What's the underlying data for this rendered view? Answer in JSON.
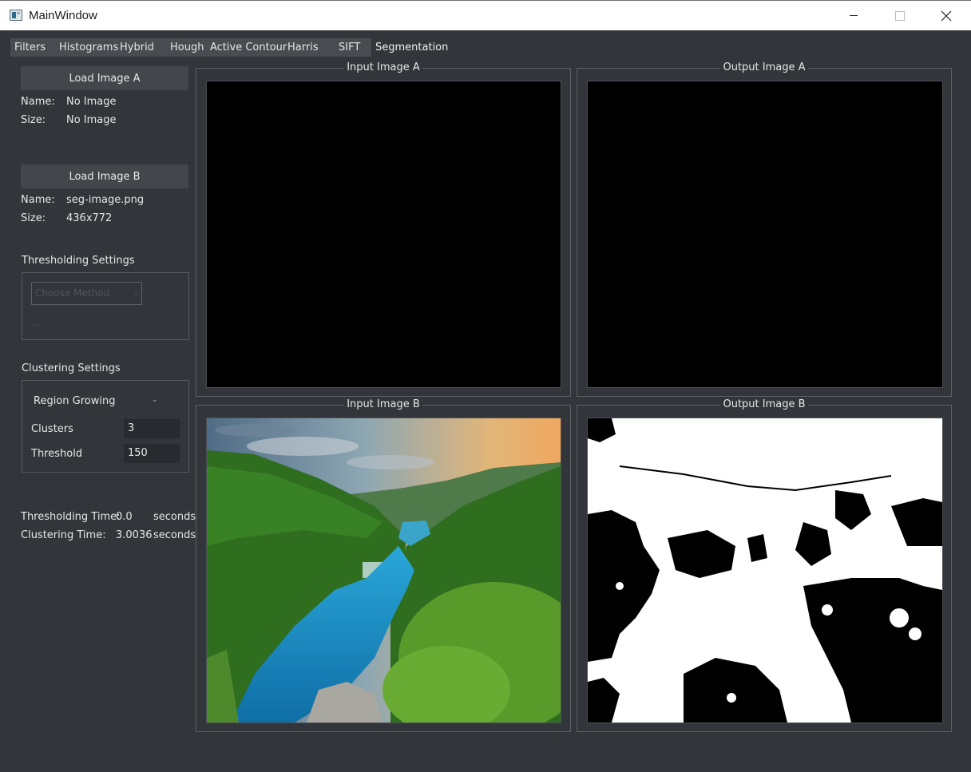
{
  "window": {
    "title": "MainWindow",
    "minimize_glyph": "—",
    "maximize_glyph": "□",
    "close_glyph": "✕"
  },
  "tabs": [
    {
      "label": "Filters"
    },
    {
      "label": "Histograms"
    },
    {
      "label": "Hybrid"
    },
    {
      "label": "Hough"
    },
    {
      "label": "Active Contour"
    },
    {
      "label": "Harris"
    },
    {
      "label": "SIFT"
    },
    {
      "label": "Segmentation"
    }
  ],
  "active_tab": "Segmentation",
  "image_a": {
    "button": "Load Image A",
    "name_label": "Name:",
    "name_value": "No Image",
    "size_label": "Size:",
    "size_value": "No Image"
  },
  "image_b": {
    "button": "Load Image B",
    "name_label": "Name:",
    "name_value": "seg-image.png",
    "size_label": "Size:",
    "size_value": "436x772"
  },
  "thresholding": {
    "title": "Thresholding Settings",
    "method_placeholder": "Choose Method",
    "dots": "..."
  },
  "clustering": {
    "title": "Clustering Settings",
    "method": "Region Growing",
    "clusters_label": "Clusters",
    "clusters_value": "3",
    "threshold_label": "Threshold",
    "threshold_value": "150"
  },
  "timing": {
    "thresholding_label": "Thresholding Time:",
    "thresholding_value": "0.0",
    "clustering_label": "Clustering Time:",
    "clustering_value": "3.0036",
    "unit": "seconds"
  },
  "views": {
    "input_a": "Input Image A",
    "output_a": "Output Image A",
    "input_b": "Input Image B",
    "output_b": "Output Image B"
  },
  "colors": {
    "background": "#32363a",
    "button": "#43474b",
    "view_empty": "#000000",
    "lake": "#1596d3",
    "forest": "#2f6d1f"
  }
}
